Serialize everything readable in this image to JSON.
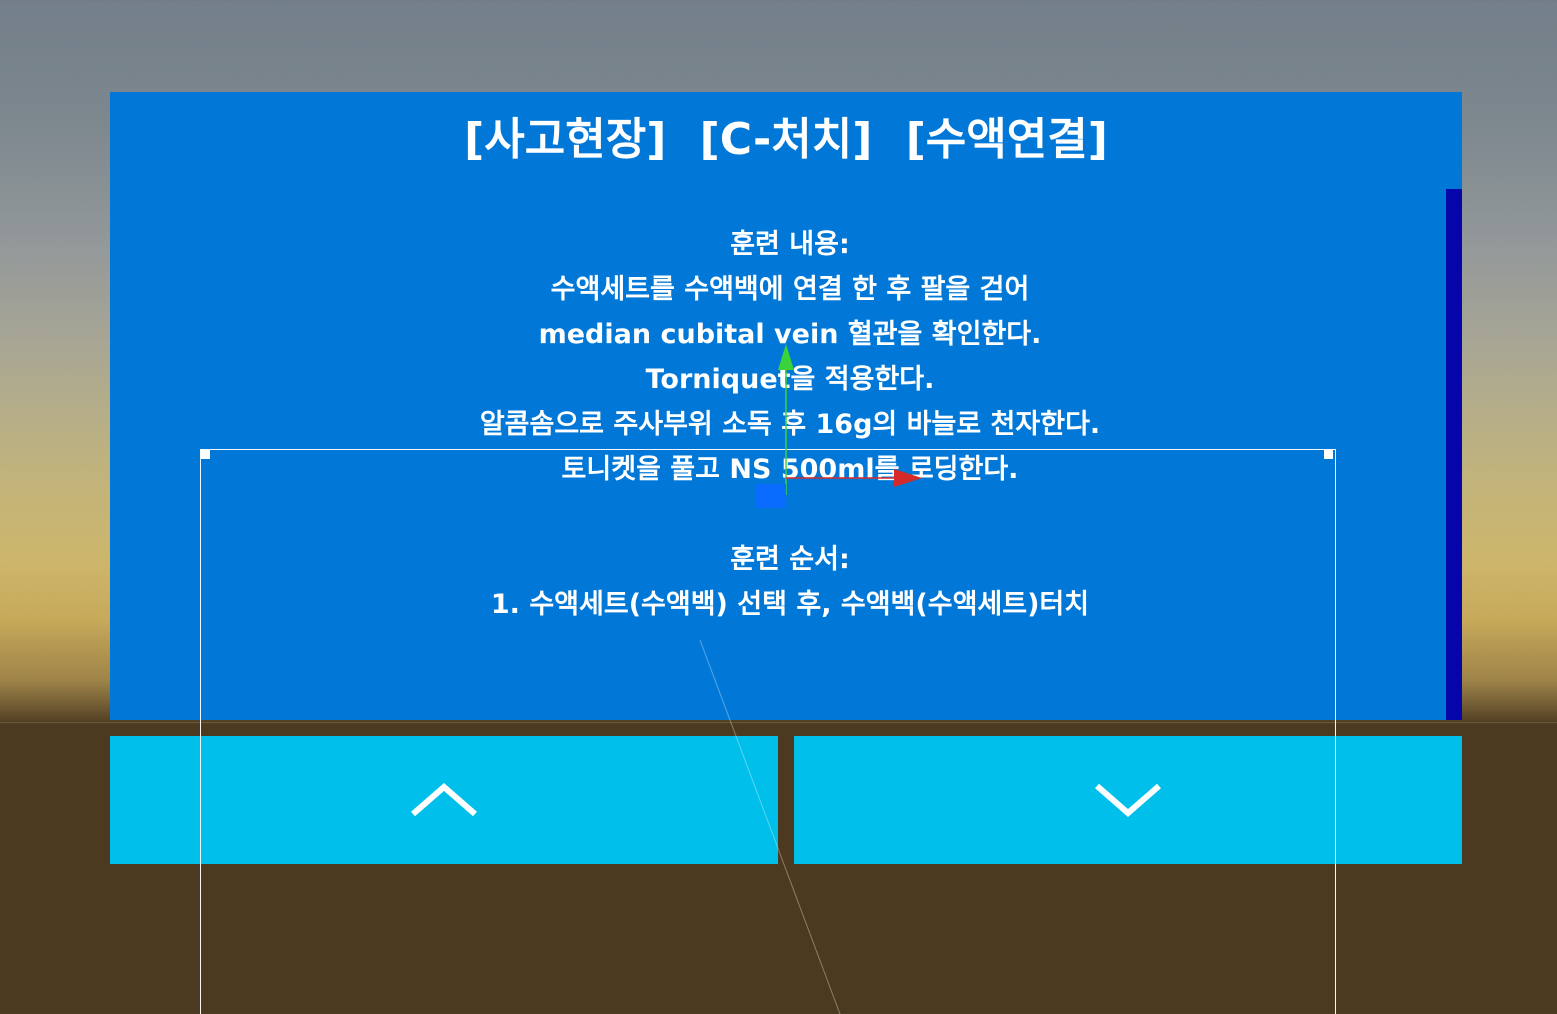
{
  "panel": {
    "title": "[사고현장]  [C-처치]  [수액연결]",
    "lines": [
      "훈련 내용:",
      "수액세트를 수액백에 연결 한 후 팔을 걷어",
      "median cubital vein 혈관을 확인한다.",
      "Torniquet을 적용한다.",
      "알콤솜으로 주사부위 소독 후 16g의 바늘로 천자한다.",
      "토니켓을 풀고 NS 500ml를 로딩한다.",
      "",
      "훈련 순서:",
      "1. 수액세트(수액백) 선택 후, 수액백(수액세트)터치"
    ]
  },
  "buttons": {
    "up_icon": "chevron-up-icon",
    "down_icon": "chevron-down-icon"
  },
  "colors": {
    "panel_bg": "#0178d7",
    "scrollbar": "#0505a9",
    "button_bg": "#00bfeb",
    "gizmo_y_axis": "#3ad43a",
    "gizmo_x_axis": "#d42a2a",
    "gizmo_center": "#0a6cff"
  }
}
